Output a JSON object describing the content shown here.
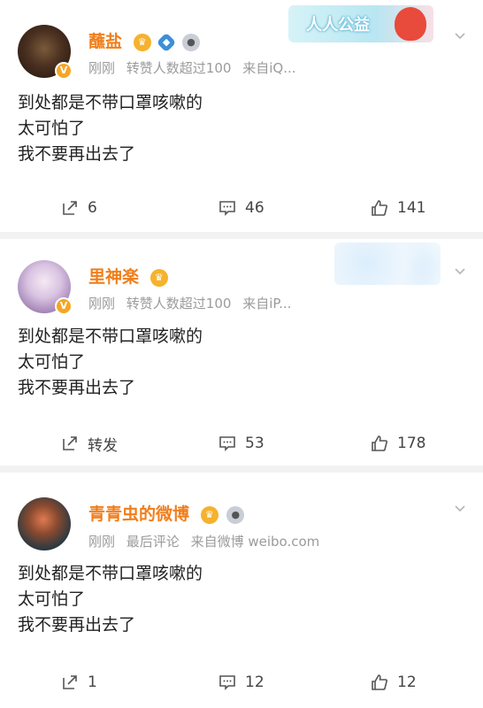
{
  "posts": [
    {
      "username": "蘸盐",
      "meta": {
        "time": "刚刚",
        "note": "转赞人数超过100",
        "source": "来自iQ..."
      },
      "content": [
        "到处都是不带口罩咳嗽的",
        "太可怕了",
        "我不要再出去了"
      ],
      "actions": {
        "repost": "6",
        "comment": "46",
        "like": "141"
      },
      "decor_text": "人人公益"
    },
    {
      "username": "里神楽",
      "meta": {
        "time": "刚刚",
        "note": "转赞人数超过100",
        "source": "来自iP..."
      },
      "content": [
        "到处都是不带口罩咳嗽的",
        "太可怕了",
        "我不要再出去了"
      ],
      "actions": {
        "repost": "转发",
        "comment": "53",
        "like": "178"
      }
    },
    {
      "username": "青青虫的微博",
      "meta": {
        "time": "刚刚",
        "note": "最后评论",
        "source": "来自微博 weibo.com"
      },
      "content": [
        "到处都是不带口罩咳嗽的",
        "太可怕了",
        "我不要再出去了"
      ],
      "actions": {
        "repost": "1",
        "comment": "12",
        "like": "12"
      }
    }
  ],
  "colors": {
    "username": "#f07e1b",
    "meta": "#9b9b9b",
    "text": "#222222",
    "divider": "#f2f2f2"
  },
  "icons": [
    "avatar",
    "verified-v-icon",
    "crown-badge-icon",
    "shield-badge-icon",
    "medal-badge-icon",
    "chevron-down-icon",
    "repost-icon",
    "comment-icon",
    "like-icon"
  ]
}
